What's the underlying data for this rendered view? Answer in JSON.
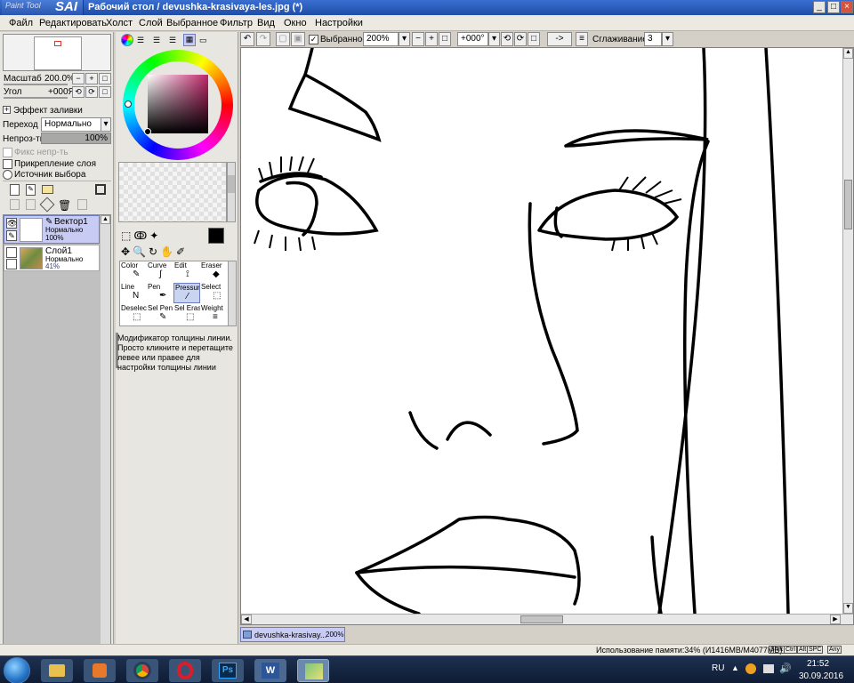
{
  "window": {
    "logo_small": "Paint Tool",
    "logo_big": "SAI",
    "title": "Рабочий стол / devushka-krasivaya-les.jpg (*)",
    "min": "_",
    "max": "□",
    "close": "×"
  },
  "menu": [
    "Файл",
    "Редактировать",
    "Холст",
    "Слой",
    "Выбранное",
    "Фильтр",
    "Вид",
    "Окно",
    "Настройки"
  ],
  "toolbar": {
    "selection_label": "Выбранное",
    "zoom_value": "200%",
    "minus": "−",
    "plus": "+",
    "angle_value": "+000°",
    "arrow_btn": "->",
    "smoothing_label": "Сглаживание",
    "smoothing_value": "3"
  },
  "navigator": {
    "scale_label": "Масштаб",
    "scale_value": "200.0%",
    "angle_label": "Угол",
    "angle_value": "+000Я"
  },
  "layer_props": {
    "fill_effect": "Эффект заливки",
    "blend_label": "Переход",
    "blend_value": "Нормально",
    "opacity_label": "Непроз-ть",
    "opacity_value": "100%",
    "opacity_fraction": 1.0,
    "fix_opacity": "Фикс непр-ть",
    "clipping": "Прикрепление слоя",
    "selection_source": "Источник выбора"
  },
  "layers": [
    {
      "name": "Вектор1",
      "mode": "Нормально",
      "opacity": "100%"
    },
    {
      "name": "Слой1",
      "mode": "Нормально",
      "opacity": "41%"
    }
  ],
  "tools": [
    {
      "label": "Color",
      "icon": "✎"
    },
    {
      "label": "Curve",
      "icon": "∫"
    },
    {
      "label": "Edit",
      "icon": "⟟"
    },
    {
      "label": "Eraser",
      "icon": "◆"
    },
    {
      "label": "Line",
      "icon": "N"
    },
    {
      "label": "Pen",
      "icon": "✒"
    },
    {
      "label": "Pressure",
      "icon": "⁄"
    },
    {
      "label": "Select",
      "icon": "⬚"
    },
    {
      "label": "Deselect",
      "icon": "⬚"
    },
    {
      "label": "Sel Pen",
      "icon": "✎"
    },
    {
      "label": "Sel Eras",
      "icon": "⬚"
    },
    {
      "label": "Weight",
      "icon": "≡"
    }
  ],
  "tool_help": "Модификатор толщины линии. Просто кликните и перетащите левее или правее для настройки толщины линии",
  "document_tab": {
    "name": "devushka-krasivay...",
    "zoom": "200%"
  },
  "status": {
    "memory": "Использование памяти:34% (И1416MB/M4077MB)",
    "keys": [
      "Shift",
      "Ctrl",
      "Alt",
      "SPC",
      "Any"
    ]
  },
  "taskbar": {
    "lang": "RU",
    "time": "21:52",
    "date": "30.09.2016"
  },
  "colors": {
    "title_bg": "#1e4ea8",
    "current_color": "#000000",
    "selected_tool_bg": "#c8d4f0"
  }
}
